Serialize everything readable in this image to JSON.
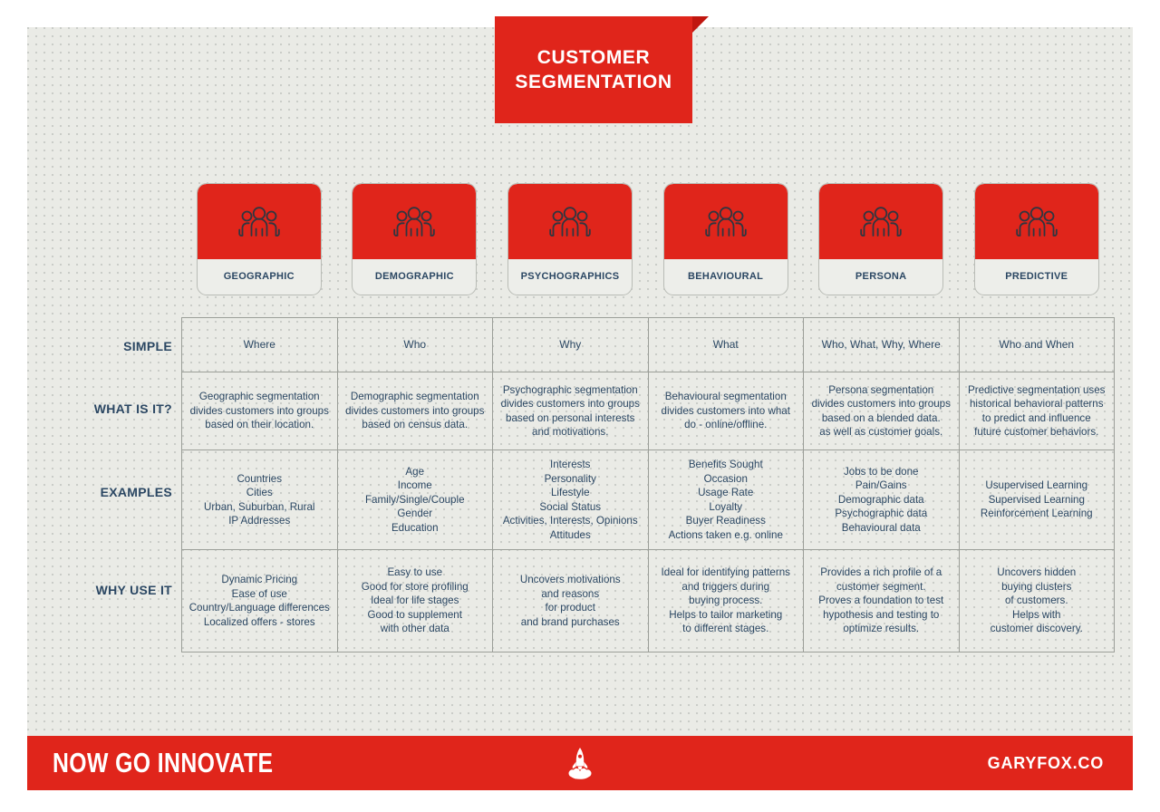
{
  "title": {
    "line1": "CUSTOMER",
    "line2": "SEGMENTATION"
  },
  "colors": {
    "brand_red": "#e0251b",
    "fold_red": "#c0160f",
    "board_bg": "#eaebe6",
    "text_navy": "#2b4763",
    "border_gray": "#9b9e98"
  },
  "cards": [
    {
      "label": "GEOGRAPHIC",
      "icon": "people-group-icon"
    },
    {
      "label": "DEMOGRAPHIC",
      "icon": "people-group-icon"
    },
    {
      "label": "PSYCHOGRAPHICS",
      "icon": "people-group-icon"
    },
    {
      "label": "BEHAVIOURAL",
      "icon": "people-group-icon"
    },
    {
      "label": "PERSONA",
      "icon": "people-group-icon"
    },
    {
      "label": "PREDICTIVE",
      "icon": "people-group-icon"
    }
  ],
  "row_labels": {
    "simple": "SIMPLE",
    "what_is_it": "WHAT IS IT?",
    "examples": "EXAMPLES",
    "why_use_it": "WHY USE IT"
  },
  "rows": {
    "simple": [
      "Where",
      "Who",
      "Why",
      "What",
      "Who, What, Why, Where",
      "Who and When"
    ],
    "what_is_it": [
      "Geographic segmentation\ndivides customers into groups\nbased on their location.",
      "Demographic segmentation\ndivides customers into groups\nbased on census data.",
      "Psychographic segmentation\ndivides customers into groups\nbased on personal interests\nand motivations.",
      "Behavioural segmentation\ndivides customers into what\ndo - online/offline.",
      "Persona segmentation\ndivides customers into groups\nbased on a blended data.\nas well as customer goals.",
      "Predictive segmentation uses\nhistorical behavioral patterns\nto predict and influence\nfuture customer behaviors."
    ],
    "examples": [
      "Countries\nCities\nUrban, Suburban, Rural\nIP Addresses",
      "Age\nIncome\nFamily/Single/Couple\nGender\nEducation",
      "Interests\nPersonality\nLifestyle\nSocial Status\nActivities, Interests, Opinions\nAttitudes",
      "Benefits Sought\nOccasion\nUsage Rate\nLoyalty\nBuyer Readiness\nActions taken e.g. online",
      "Jobs to be done\nPain/Gains\nDemographic data\nPsychographic data\nBehavioural data",
      "Usupervised Learning\nSupervised Learning\nReinforcement Learning"
    ],
    "why_use_it": [
      "Dynamic Pricing\nEase of use\nCountry/Language differences\nLocalized offers - stores",
      "Easy to use\nGood for store profiling\nIdeal for life stages\nGood to supplement\nwith other data",
      "Uncovers motivations\nand reasons\nfor product\nand brand purchases",
      "Ideal for identifying patterns\nand triggers during\nbuying process.\nHelps to tailor marketing\nto different stages.",
      "Provides a rich profile of a\ncustomer segment.\nProves a foundation to test\nhypothesis and testing to\noptimize results.",
      "Uncovers hidden\nbuying clusters\nof customers.\nHelps with\ncustomer discovery."
    ]
  },
  "footer": {
    "tagline": "NOW GO INNOVATE",
    "brand": "GARYFOX.CO",
    "center_icon": "rocket-launch-icon"
  }
}
